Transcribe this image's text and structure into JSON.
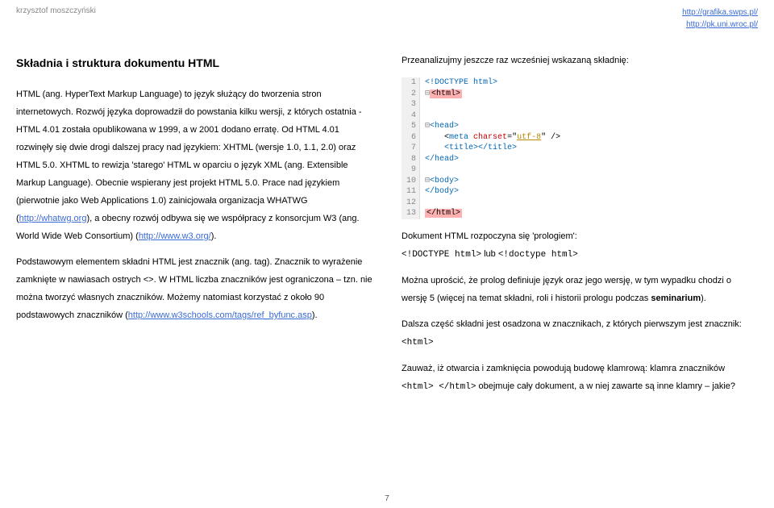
{
  "header": {
    "author": "krzysztof moszczyński",
    "link1": "http://grafika.swps.pl/",
    "link2": "http://pk.uni.wroc.pl/"
  },
  "left": {
    "title": "Składnia i struktura dokumentu HTML",
    "p1a": "HTML (ang. HyperText Markup Language) to język służący do tworzenia stron internetowych. Rozwój języka doprowadził do powstania kilku wersji, z których ostatnia - HTML 4.01 została opublikowana w 1999, a w 2001 dodano erratę. Od HTML 4.01 rozwinęły się dwie drogi dalszej pracy nad językiem: XHTML (wersje 1.0, 1.1, 2.0) oraz HTML 5.0. XHTML to rewizja 'starego' HTML w oparciu o język XML (ang. Extensible Markup Language). Obecnie wspierany jest projekt HTML 5.0. Prace nad językiem (pierwotnie jako Web Applications 1.0) zainicjowała organizacja WHATWG (",
    "p1link1": "http://whatwg.org",
    "p1b": "), a obecny rozwój odbywa się we współpracy z konsorcjum W3 (ang. World Wide Web Consortium) (",
    "p1link2": "http://www.w3.org/",
    "p1c": ").",
    "p2a": "Podstawowym elementem składni HTML jest znacznik (ang. tag). Znacznik to wyrażenie zamknięte w nawiasach ostrych <>. W HTML liczba znaczników jest ograniczona – tzn. nie można tworzyć własnych znaczników. Możemy natomiast korzystać z około 90 podstawowych znaczników (",
    "p2link": "http://www.w3schools.com/tags/ref_byfunc.asp",
    "p2b": ")."
  },
  "right": {
    "intro": "Przeanalizujmy jeszcze raz wcześniej wskazaną składnię:",
    "code": {
      "l1": "<!DOCTYPE html>",
      "l2_hl": "<html>",
      "l5_tog": "⊟",
      "l5": "<head>",
      "l6a": "    <",
      "l6kw": "meta",
      "l6b": " ",
      "l6attr": "charset",
      "l6c": "=\"",
      "l6val": "utf-8",
      "l6d": "\" />",
      "l7": "    <title></title>",
      "l8": "</head>",
      "l10_tog": "⊟",
      "l10": "<body>",
      "l11": "</body>",
      "l13_hl": "</html>"
    },
    "p1a": "Dokument HTML rozpoczyna się 'prologiem':",
    "p1code1": "<!DOCTYPE html>",
    "p1mid": " lub ",
    "p1code2": "<!doctype html>",
    "p2": "Można uprościć, że prolog definiuje język oraz jego wersję, w tym wypadku chodzi o wersję 5 (więcej na temat składni, roli i historii prologu podczas ",
    "p2bold": "seminarium",
    "p2end": ").",
    "p3": "Dalsza część składni jest osadzona w znacznikach, z których pierwszym jest znacznik:",
    "p3code": "<html>",
    "p4a": "Zauważ, iż otwarcia i zamknięcia powodują budowę klamrową: klamra znaczników ",
    "p4code": "<html> </html>",
    "p4b": " obejmuje cały dokument, a w niej zawarte są inne klamry – jakie?"
  },
  "page_number": "7"
}
